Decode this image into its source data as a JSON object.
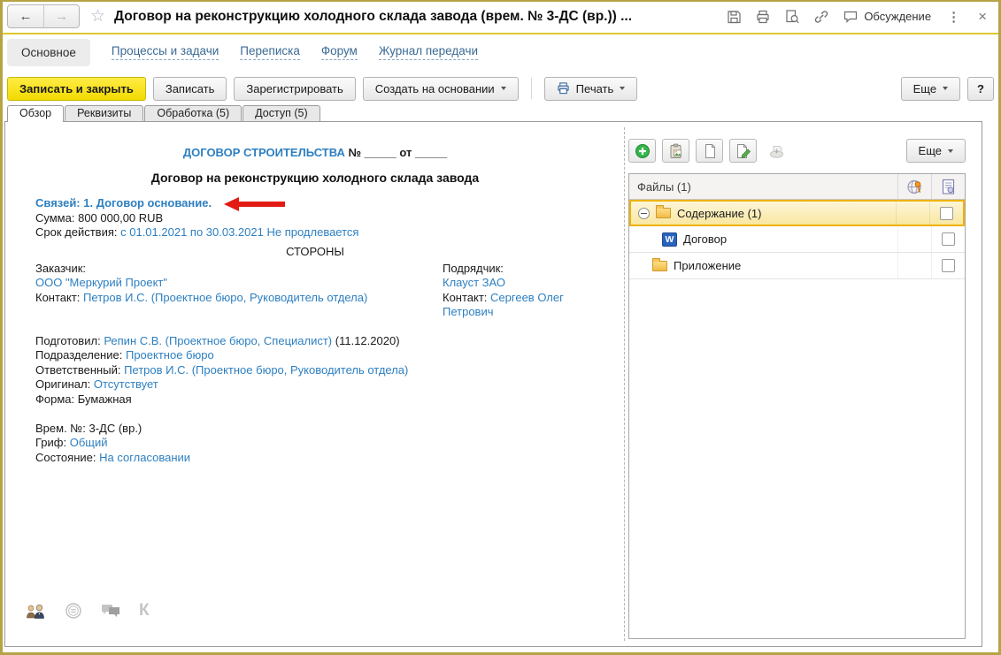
{
  "colors": {
    "accent_yellow": "#f2da00",
    "window_frame": "#b5a445",
    "link_blue": "#2d7fc1",
    "selection_border": "#efb301",
    "arrow_red": "#e31b12"
  },
  "icons": {
    "back": "←",
    "forward": "→",
    "star": "☆",
    "kebab": "⋮",
    "close": "×",
    "k_badge": "К",
    "word_badge": "W"
  },
  "titlebar": {
    "title": "Договор на реконструкцию холодного склада завода (врем. № 3-ДС (вр.)) ...",
    "discussion": "Обсуждение"
  },
  "nav": {
    "main": "Основное",
    "processes": "Процессы и задачи",
    "mail": "Переписка",
    "forum": "Форум",
    "journal": "Журнал передачи"
  },
  "toolbar": {
    "save_close": "Записать и закрыть",
    "save": "Записать",
    "register": "Зарегистрировать",
    "create_from": "Создать на основании",
    "print": "Печать",
    "more": "Еще",
    "help": "?"
  },
  "tabs": {
    "overview": "Обзор",
    "details": "Реквизиты",
    "processing": "Обработка (5)",
    "access": "Доступ (5)"
  },
  "doc": {
    "heading_blue": "ДОГОВОР СТРОИТЕЛЬСТВА",
    "heading_black": "№ _____ от _____",
    "title": "Договор на реконструкцию холодного склада завода",
    "links_line": "Связей: 1. Договор основание.",
    "amount_label": "Сумма:",
    "amount_value": "800 000,00 RUB",
    "period_label": "Срок действия:",
    "period_value": "с 01.01.2021 по 30.03.2021 Не продлевается",
    "parties_heading": "СТОРОНЫ",
    "customer_label": "Заказчик:",
    "customer_name": "ООО \"Меркурий Проект\"",
    "customer_contact_label": "Контакт:",
    "customer_contact": "Петров И.С. (Проектное бюро, Руководитель отдела)",
    "contractor_label": "Подрядчик:",
    "contractor_name": "Клауст ЗАО",
    "contractor_contact_label": "Контакт:",
    "contractor_contact": "Сергеев Олег Петрович",
    "prepared_label": "Подготовил:",
    "prepared_value": "Репин С.В. (Проектное бюро, Специалист)",
    "prepared_date": "(11.12.2020)",
    "department_label": "Подразделение:",
    "department_value": "Проектное бюро",
    "responsible_label": "Ответственный:",
    "responsible_value": "Петров И.С. (Проектное бюро, Руководитель отдела)",
    "original_label": "Оригинал:",
    "original_value": "Отсутствует",
    "form_label": "Форма:",
    "form_value": "Бумажная",
    "temp_number_label": "Врем. №:",
    "temp_number_value": "3-ДС (вр.)",
    "stamp_label": "Гриф:",
    "stamp_value": "Общий",
    "state_label": "Состояние:",
    "state_value": "На согласовании"
  },
  "files": {
    "more": "Еще",
    "header": "Файлы (1)",
    "rows": [
      {
        "label": "Содержание (1)"
      },
      {
        "label": "Договор"
      },
      {
        "label": "Приложение"
      }
    ]
  }
}
